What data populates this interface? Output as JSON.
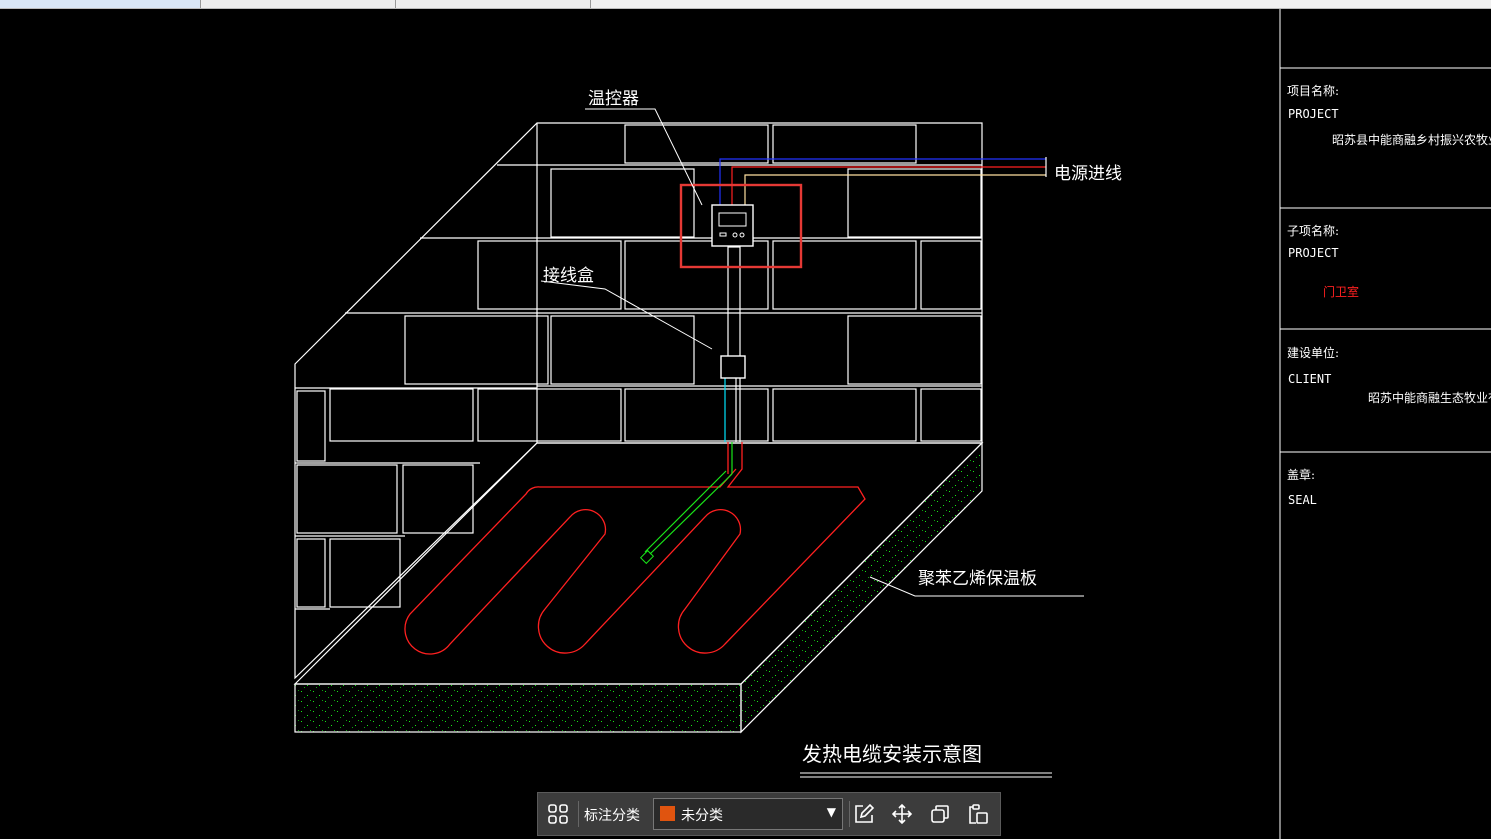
{
  "colors": {
    "accent_red": "#ff0000",
    "swatch": "#e0540f",
    "toolbar_bg": "#3c3c3c"
  },
  "drawing": {
    "labels": {
      "thermostat": "温控器",
      "junction_box": "接线盒",
      "power_in": "电源进线",
      "insulation": "聚苯乙烯保温板",
      "title": "发热电缆安装示意图"
    }
  },
  "title_block": {
    "project_name_label": "项目名称:",
    "project_label": "PROJECT",
    "project_value": "昭苏县中能商融乡村振兴农牧业全产业",
    "subitem_label": "子项名称:",
    "subitem_project_label": "PROJECT",
    "subitem_value": "门卫室",
    "client_name_label": "建设单位:",
    "client_label": "CLIENT",
    "client_value": "昭苏中能商融生态牧业有限公",
    "seal_label": "盖章:",
    "seal_value": "SEAL"
  },
  "toolbar": {
    "grid_icon": "grid-icon",
    "category_label": "标注分类",
    "category_value": "未分类",
    "edit_icon": "edit-icon",
    "move_icon": "move-icon",
    "copy_icon": "copy-icon",
    "paste_icon": "paste-icon"
  }
}
